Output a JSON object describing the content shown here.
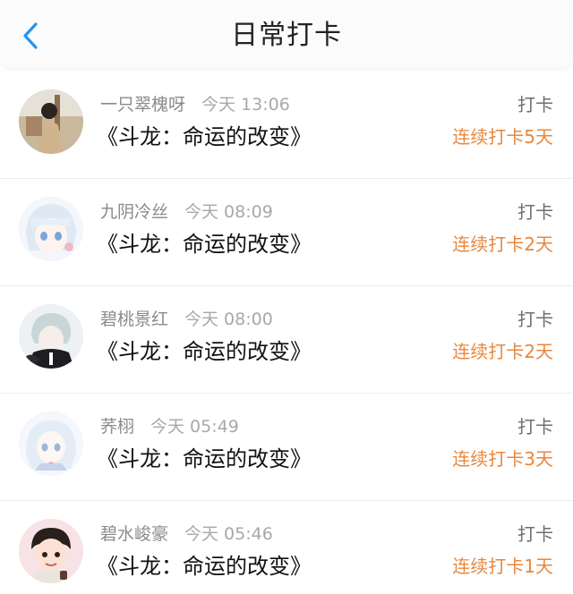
{
  "header": {
    "title": "日常打卡",
    "back_icon": "chevron-left-icon",
    "accent_color": "#2196f3"
  },
  "colors": {
    "streak": "#e8873d",
    "name": "#8a8a8a",
    "title": "#111111"
  },
  "entries": [
    {
      "name": "一只翠槐呀",
      "time": "今天 13:06",
      "title": "《斗龙：命运的改变》",
      "action": "打卡",
      "streak": "连续打卡5天"
    },
    {
      "name": "九阴冷丝",
      "time": "今天 08:09",
      "title": "《斗龙：命运的改变》",
      "action": "打卡",
      "streak": "连续打卡2天"
    },
    {
      "name": "碧桃景红",
      "time": "今天 08:00",
      "title": "《斗龙：命运的改变》",
      "action": "打卡",
      "streak": "连续打卡2天"
    },
    {
      "name": "荞栩",
      "time": "今天 05:49",
      "title": "《斗龙：命运的改变》",
      "action": "打卡",
      "streak": "连续打卡3天"
    },
    {
      "name": "碧水峻豪",
      "time": "今天 05:46",
      "title": "《斗龙：命运的改变》",
      "action": "打卡",
      "streak": "连续打卡1天"
    }
  ]
}
